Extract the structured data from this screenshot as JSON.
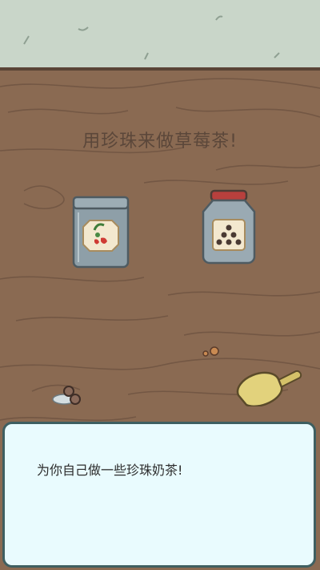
{
  "scene": {
    "title": "用珍珠来做草莓茶!",
    "colors": {
      "wall": "#c9d6c9",
      "table": "#8a6a52",
      "wood_grain": "#6f5442",
      "dialog_bg": "#e9fbfe",
      "dialog_border": "#3e5f61"
    }
  },
  "items": {
    "strawberry_jar": {
      "icon": "strawberry-jar-icon"
    },
    "pearl_jar": {
      "icon": "tapioca-pearl-jar-icon"
    },
    "spilled_pearls": {
      "icon": "spilled-pearls-icon"
    },
    "scoop": {
      "icon": "scoop-icon"
    }
  },
  "dialog": {
    "text": "为你自己做一些珍珠奶茶!"
  }
}
